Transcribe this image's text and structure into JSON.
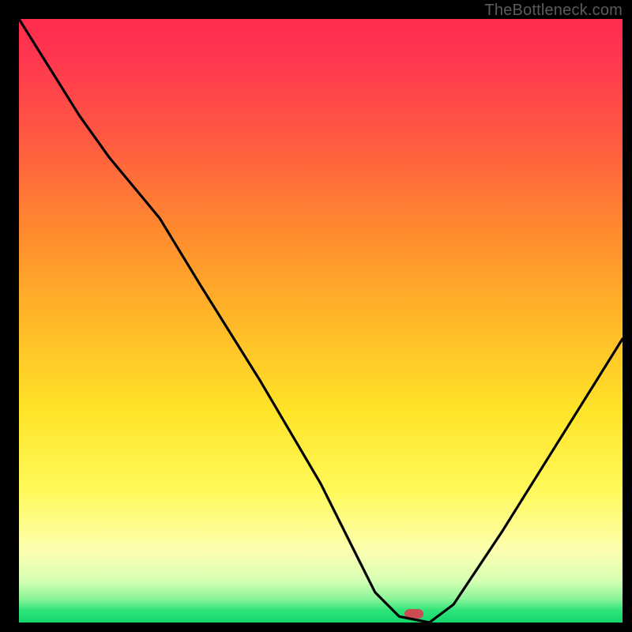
{
  "watermark": "TheBottleneck.com",
  "marker": {
    "x_frac": 0.655,
    "y_frac": 0.985
  },
  "chart_data": {
    "type": "line",
    "title": "",
    "xlabel": "",
    "ylabel": "",
    "xlim": [
      0,
      1
    ],
    "ylim": [
      0,
      1
    ],
    "series": [
      {
        "name": "bottleneck-curve",
        "x": [
          0.0,
          0.05,
          0.1,
          0.15,
          0.2,
          0.233,
          0.3,
          0.4,
          0.5,
          0.56,
          0.59,
          0.63,
          0.68,
          0.72,
          0.8,
          0.9,
          1.0
        ],
        "y": [
          1.0,
          0.92,
          0.84,
          0.77,
          0.71,
          0.67,
          0.56,
          0.4,
          0.23,
          0.11,
          0.05,
          0.01,
          0.0,
          0.03,
          0.15,
          0.31,
          0.47
        ]
      }
    ],
    "annotations": [
      {
        "type": "marker",
        "x": 0.655,
        "y": 0.0,
        "label": "optimal-point"
      }
    ],
    "background_gradient": {
      "direction": "vertical",
      "stops": [
        {
          "pos": 0.0,
          "color": "#ff2b4d"
        },
        {
          "pos": 0.5,
          "color": "#ffb828"
        },
        {
          "pos": 0.88,
          "color": "#fdffb0"
        },
        {
          "pos": 1.0,
          "color": "#13d76c"
        }
      ]
    }
  }
}
